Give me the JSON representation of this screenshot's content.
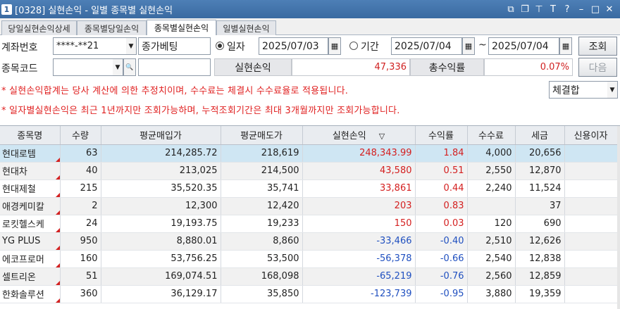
{
  "window": {
    "num": "1",
    "title": "[0328] 실현손익 - 일별 종목별 실현손익",
    "icons": [
      "restore-icon",
      "copy-icon",
      "pin-icon",
      "font-icon",
      "help-icon",
      "minimize-icon",
      "maximize-icon",
      "close-icon"
    ]
  },
  "tabs": [
    {
      "label": "당일실현손익상세",
      "active": false
    },
    {
      "label": "종목별당일손익",
      "active": false
    },
    {
      "label": "종목별실현손익",
      "active": true
    },
    {
      "label": "일별실현손익",
      "active": false
    }
  ],
  "form": {
    "account_label": "계좌번호",
    "account_value": "****-**21",
    "account_name": "종가베팅",
    "radio_date_label": "일자",
    "date_value": "2025/07/03",
    "radio_period_label": "기간",
    "period_from": "2025/07/04",
    "period_sep": "~",
    "period_to": "2025/07/04",
    "query_button": "조회",
    "stock_code_label": "종목코드",
    "stock_code_value": "",
    "stock_name_value": "",
    "realized_label": "실현손익",
    "realized_value": "47,336",
    "total_return_label": "총수익률",
    "total_return_value": "0.07%",
    "next_button": "다음",
    "notice1": "* 실현손익합계는 당사 계산에 의한 추정치이며, 수수료는 체결시 수수료율로 적용됩니다.",
    "notice2": "* 일자별실현손익은 최근 1년까지만 조회가능하며, 누적조회기간은 최대 3개월까지만 조회가능합니다.",
    "filter_select": "체결합"
  },
  "table": {
    "columns": [
      "종목명",
      "수량",
      "평균매입가",
      "평균매도가",
      "실현손익",
      "수익률",
      "수수료",
      "세금",
      "신용이자"
    ],
    "sort_indicator": "▽",
    "rows": [
      {
        "name": "현대로템",
        "qty": "63",
        "buy": "214,285.72",
        "sell": "218,619",
        "pnl": "248,343.99",
        "rate": "1.84",
        "fee": "4,000",
        "tax": "20,656",
        "credit": "",
        "sign": "pos"
      },
      {
        "name": "현대차",
        "qty": "40",
        "buy": "213,025",
        "sell": "214,500",
        "pnl": "43,580",
        "rate": "0.51",
        "fee": "2,550",
        "tax": "12,870",
        "credit": "",
        "sign": "pos"
      },
      {
        "name": "현대제철",
        "qty": "215",
        "buy": "35,520.35",
        "sell": "35,741",
        "pnl": "33,861",
        "rate": "0.44",
        "fee": "2,240",
        "tax": "11,524",
        "credit": "",
        "sign": "pos"
      },
      {
        "name": "애경케미칼",
        "qty": "2",
        "buy": "12,300",
        "sell": "12,420",
        "pnl": "203",
        "rate": "0.83",
        "fee": "",
        "tax": "37",
        "credit": "",
        "sign": "pos"
      },
      {
        "name": "로킷헬스케",
        "qty": "24",
        "buy": "19,193.75",
        "sell": "19,233",
        "pnl": "150",
        "rate": "0.03",
        "fee": "120",
        "tax": "690",
        "credit": "",
        "sign": "pos"
      },
      {
        "name": "YG PLUS",
        "qty": "950",
        "buy": "8,880.01",
        "sell": "8,860",
        "pnl": "-33,466",
        "rate": "-0.40",
        "fee": "2,510",
        "tax": "12,626",
        "credit": "",
        "sign": "neg"
      },
      {
        "name": "에코프로머",
        "qty": "160",
        "buy": "53,756.25",
        "sell": "53,500",
        "pnl": "-56,378",
        "rate": "-0.66",
        "fee": "2,540",
        "tax": "12,838",
        "credit": "",
        "sign": "neg"
      },
      {
        "name": "셀트리온",
        "qty": "51",
        "buy": "169,074.51",
        "sell": "168,098",
        "pnl": "-65,219",
        "rate": "-0.76",
        "fee": "2,560",
        "tax": "12,859",
        "credit": "",
        "sign": "neg"
      },
      {
        "name": "한화솔루션",
        "qty": "360",
        "buy": "36,129.17",
        "sell": "35,850",
        "pnl": "-123,739",
        "rate": "-0.95",
        "fee": "3,880",
        "tax": "19,359",
        "credit": "",
        "sign": "neg"
      }
    ]
  },
  "colors": {
    "title_bar": "#3a6aa1",
    "positive": "#d42020",
    "negative": "#2050c0",
    "selected_row": "#cfe6f3"
  }
}
